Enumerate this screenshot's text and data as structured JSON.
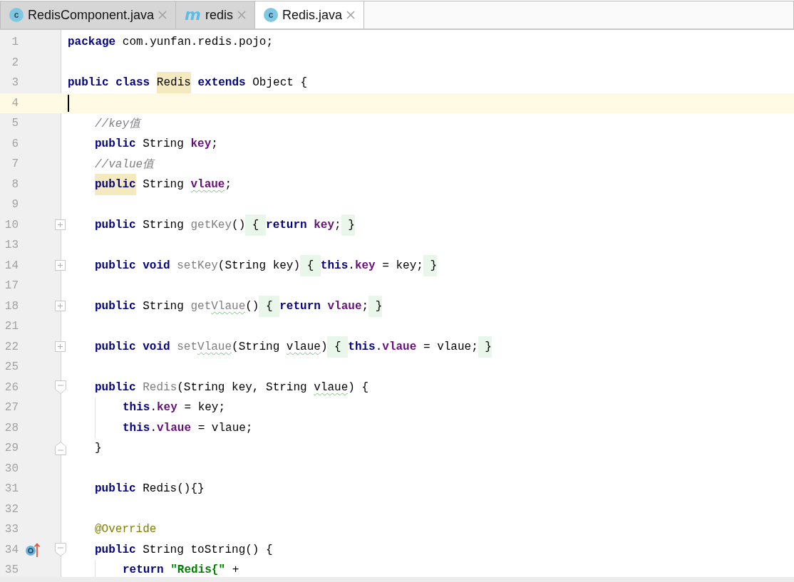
{
  "tabs": [
    {
      "label": "RedisComponent.java",
      "kind": "class",
      "icon_letter": "c",
      "selected": false
    },
    {
      "label": "redis",
      "kind": "maven",
      "icon_letter": "m",
      "selected": false
    },
    {
      "label": "Redis.java",
      "kind": "class",
      "icon_letter": "c",
      "selected": true
    }
  ],
  "editor": {
    "lines": [
      {
        "number": "1",
        "tokens": [
          {
            "text": "package ",
            "kind": "keyword"
          },
          {
            "text": "com.yunfan.redis.pojo;",
            "kind": "plain"
          }
        ]
      },
      {
        "number": "2"
      },
      {
        "number": "3",
        "tokens": [
          {
            "text": "public class ",
            "kind": "keyword"
          },
          {
            "text": "Redis",
            "kind": "plain",
            "marked": true
          },
          {
            "text": " extends",
            "kind": "keyword"
          },
          {
            "text": " Object {",
            "kind": "plain"
          }
        ]
      },
      {
        "number": "4",
        "current": true
      },
      {
        "number": "5",
        "indented": true,
        "tokens": [
          {
            "text": "//key值",
            "kind": "comment"
          }
        ]
      },
      {
        "number": "6",
        "indented": true,
        "tokens": [
          {
            "text": "public",
            "kind": "keyword"
          },
          {
            "text": " String ",
            "kind": "plain"
          },
          {
            "text": "key",
            "kind": "field"
          },
          {
            "text": ";",
            "kind": "plain"
          }
        ]
      },
      {
        "number": "7",
        "indented": true,
        "tokens": [
          {
            "text": "//value值",
            "kind": "comment"
          }
        ]
      },
      {
        "number": "8",
        "indented": true,
        "tokens": [
          {
            "text": "public",
            "kind": "keyword",
            "marked": true
          },
          {
            "text": " String ",
            "kind": "plain"
          },
          {
            "text": "vlaue",
            "kind": "field",
            "typo": true
          },
          {
            "text": ";",
            "kind": "plain"
          }
        ]
      },
      {
        "number": "9"
      },
      {
        "number": "10",
        "indented": true,
        "collapsed": true,
        "tokens": [
          {
            "text": "public",
            "kind": "keyword"
          },
          {
            "text": " String ",
            "kind": "plain"
          },
          {
            "text": "getKey",
            "kind": "unused"
          },
          {
            "text": "()",
            "kind": "plain"
          },
          {
            "text": " { ",
            "kind": "plain",
            "folded": true
          },
          {
            "text": "return ",
            "kind": "keyword"
          },
          {
            "text": "key",
            "kind": "field"
          },
          {
            "text": ";",
            "kind": "plain"
          },
          {
            "text": " }",
            "kind": "plain",
            "folded": true
          }
        ]
      },
      {
        "number": "13"
      },
      {
        "number": "14",
        "indented": true,
        "collapsed": true,
        "tokens": [
          {
            "text": "public void ",
            "kind": "keyword"
          },
          {
            "text": "setKey",
            "kind": "unused"
          },
          {
            "text": "(String key)",
            "kind": "plain"
          },
          {
            "text": " { ",
            "kind": "plain",
            "folded": true
          },
          {
            "text": "this",
            "kind": "keyword"
          },
          {
            "text": ".",
            "kind": "plain"
          },
          {
            "text": "key",
            "kind": "field"
          },
          {
            "text": " = key;",
            "kind": "plain"
          },
          {
            "text": " }",
            "kind": "plain",
            "folded": true
          }
        ]
      },
      {
        "number": "17"
      },
      {
        "number": "18",
        "indented": true,
        "collapsed": true,
        "tokens": [
          {
            "text": "public",
            "kind": "keyword"
          },
          {
            "text": " String ",
            "kind": "plain"
          },
          {
            "text": "get",
            "kind": "unused"
          },
          {
            "text": "Vlaue",
            "kind": "unused",
            "typo": true
          },
          {
            "text": "()",
            "kind": "plain"
          },
          {
            "text": " { ",
            "kind": "plain",
            "folded": true
          },
          {
            "text": "return ",
            "kind": "keyword"
          },
          {
            "text": "vlaue",
            "kind": "field"
          },
          {
            "text": ";",
            "kind": "plain"
          },
          {
            "text": " }",
            "kind": "plain",
            "folded": true
          }
        ]
      },
      {
        "number": "21"
      },
      {
        "number": "22",
        "indented": true,
        "collapsed": true,
        "tokens": [
          {
            "text": "public void ",
            "kind": "keyword"
          },
          {
            "text": "set",
            "kind": "unused"
          },
          {
            "text": "Vlaue",
            "kind": "unused",
            "typo": true
          },
          {
            "text": "(String ",
            "kind": "plain"
          },
          {
            "text": "vlaue",
            "kind": "plain",
            "typo": true
          },
          {
            "text": ")",
            "kind": "plain"
          },
          {
            "text": " { ",
            "kind": "plain",
            "folded": true
          },
          {
            "text": "this",
            "kind": "keyword"
          },
          {
            "text": ".",
            "kind": "plain"
          },
          {
            "text": "vlaue",
            "kind": "field"
          },
          {
            "text": " = vlaue;",
            "kind": "plain"
          },
          {
            "text": " }",
            "kind": "plain",
            "folded": true
          }
        ]
      },
      {
        "number": "25"
      },
      {
        "number": "26",
        "indented": true,
        "fold_start": true,
        "tokens": [
          {
            "text": "public ",
            "kind": "keyword"
          },
          {
            "text": "Redis",
            "kind": "unused"
          },
          {
            "text": "(String key, String ",
            "kind": "plain"
          },
          {
            "text": "vlaue",
            "kind": "plain",
            "typo": true
          },
          {
            "text": ") {",
            "kind": "plain"
          }
        ]
      },
      {
        "number": "27",
        "guide": true,
        "tokens": [
          {
            "text": "this",
            "kind": "keyword"
          },
          {
            "text": ".",
            "kind": "plain"
          },
          {
            "text": "key",
            "kind": "field"
          },
          {
            "text": " = key;",
            "kind": "plain"
          }
        ]
      },
      {
        "number": "28",
        "guide": true,
        "tokens": [
          {
            "text": "this",
            "kind": "keyword"
          },
          {
            "text": ".",
            "kind": "plain"
          },
          {
            "text": "vlaue",
            "kind": "field"
          },
          {
            "text": " = vlaue;",
            "kind": "plain"
          }
        ]
      },
      {
        "number": "29",
        "indented": true,
        "fold_end": true,
        "tokens": [
          {
            "text": "}",
            "kind": "plain"
          }
        ]
      },
      {
        "number": "30"
      },
      {
        "number": "31",
        "indented": true,
        "tokens": [
          {
            "text": "public",
            "kind": "keyword"
          },
          {
            "text": " Redis(){}",
            "kind": "plain"
          }
        ]
      },
      {
        "number": "32"
      },
      {
        "number": "33",
        "indented": true,
        "tokens": [
          {
            "text": "@Override",
            "kind": "annotation"
          }
        ]
      },
      {
        "number": "34",
        "indented": true,
        "fold_start": true,
        "overrides": true,
        "tokens": [
          {
            "text": "public",
            "kind": "keyword"
          },
          {
            "text": " String toString() {",
            "kind": "plain"
          }
        ]
      },
      {
        "number": "35",
        "guide": true,
        "tokens": [
          {
            "text": "return ",
            "kind": "keyword"
          },
          {
            "text": "\"Redis{\"",
            "kind": "string"
          },
          {
            "text": " +",
            "kind": "plain"
          }
        ]
      }
    ]
  }
}
